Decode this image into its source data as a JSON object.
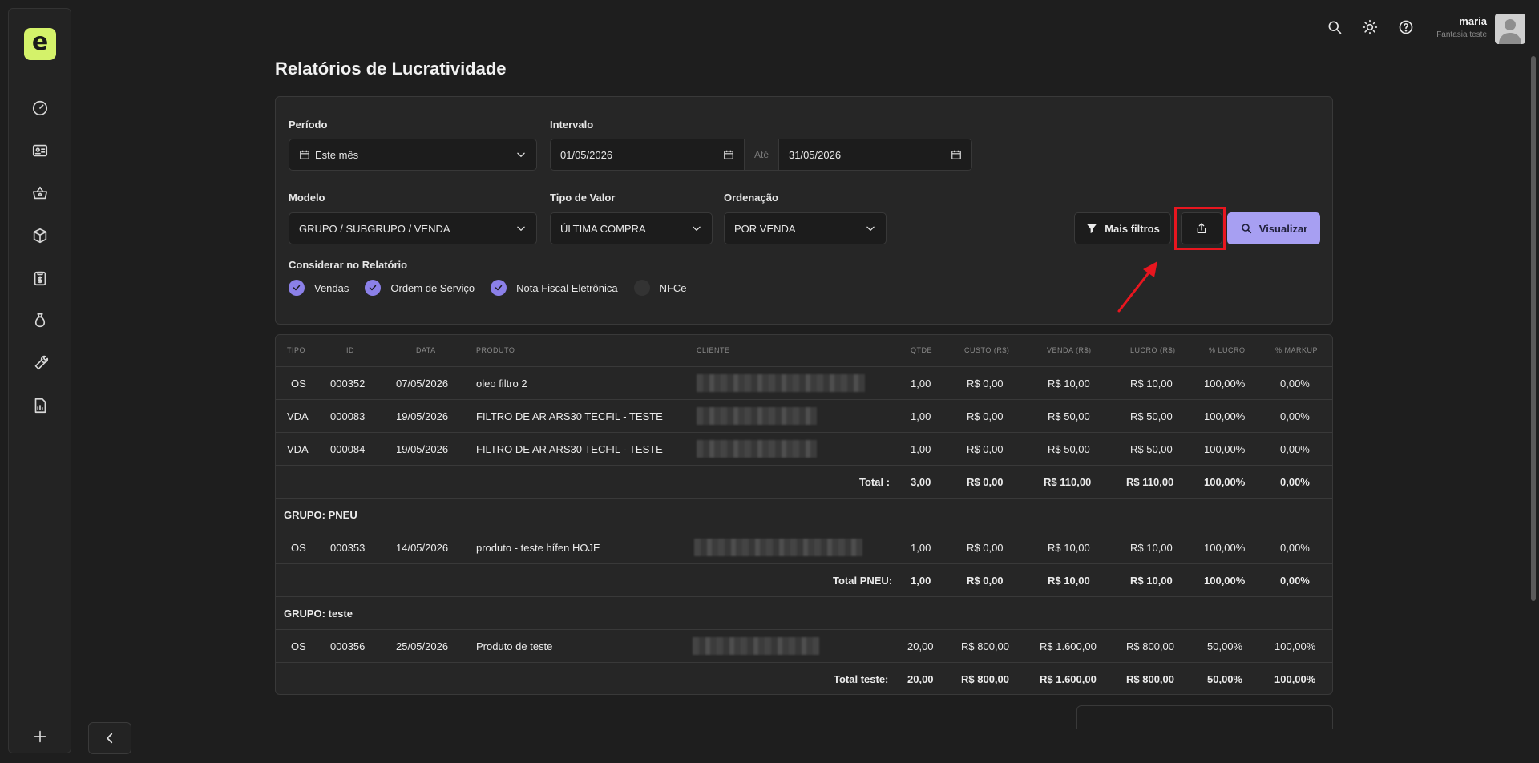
{
  "app": {
    "logo_letter": "e",
    "brand_color": "#d4f26a",
    "accent_color": "#a79ff2",
    "highlight_color": "#e8161f"
  },
  "sidebar": {
    "items": [
      {
        "icon": "dashboard-icon"
      },
      {
        "icon": "id-card-icon"
      },
      {
        "icon": "basket-icon"
      },
      {
        "icon": "box-icon"
      },
      {
        "icon": "clipboard-dollar-icon"
      },
      {
        "icon": "money-bag-icon"
      },
      {
        "icon": "wrench-icon"
      },
      {
        "icon": "report-icon"
      }
    ],
    "add_icon": "plus-icon",
    "collapse_icon": "chevron-left-icon"
  },
  "topbar": {
    "icons": [
      "search-icon",
      "sun-icon",
      "help-icon"
    ],
    "user_name": "maria",
    "user_subtitle": "Fantasia teste"
  },
  "page": {
    "title": "Relatórios de Lucratividade"
  },
  "filters": {
    "periodo_label": "Período",
    "periodo_value": "Este mês",
    "intervalo_label": "Intervalo",
    "date_from": "01/05/2026",
    "ate_label": "Até",
    "date_to": "31/05/2026",
    "modelo_label": "Modelo",
    "modelo_value": "GRUPO / SUBGRUPO / VENDA",
    "tipo_valor_label": "Tipo de Valor",
    "tipo_valor_value": "ÚLTIMA COMPRA",
    "ordenacao_label": "Ordenação",
    "ordenacao_value": "POR VENDA",
    "considerar_label": "Considerar no Relatório",
    "checks": [
      {
        "label": "Vendas",
        "checked": true
      },
      {
        "label": "Ordem de Serviço",
        "checked": true
      },
      {
        "label": "Nota Fiscal Eletrônica",
        "checked": true
      },
      {
        "label": "NFCe",
        "checked": false
      }
    ],
    "mais_filtros_label": "Mais filtros",
    "export_icon": "share-export-icon",
    "visualizar_label": "Visualizar"
  },
  "table": {
    "headers": [
      "TIPO",
      "ID",
      "DATA",
      "PRODUTO",
      "CLIENTE",
      "QTDE",
      "CUSTO (R$)",
      "VENDA (R$)",
      "LUCRO (R$)",
      "% LUCRO",
      "% MARKUP"
    ],
    "rows": [
      {
        "tipo": "OS",
        "id": "000352",
        "data": "07/05/2026",
        "produto": "oleo filtro 2",
        "qtde": "1,00",
        "custo": "R$ 0,00",
        "venda": "R$ 10,00",
        "lucro": "R$ 10,00",
        "pl": "100,00%",
        "pm": "0,00%"
      },
      {
        "tipo": "VDA",
        "id": "000083",
        "data": "19/05/2026",
        "produto": "FILTRO DE AR ARS30 TECFIL - TESTE",
        "qtde": "1,00",
        "custo": "R$ 0,00",
        "venda": "R$ 50,00",
        "lucro": "R$ 50,00",
        "pl": "100,00%",
        "pm": "0,00%"
      },
      {
        "tipo": "VDA",
        "id": "000084",
        "data": "19/05/2026",
        "produto": "FILTRO DE AR ARS30 TECFIL - TESTE",
        "qtde": "1,00",
        "custo": "R$ 0,00",
        "venda": "R$ 50,00",
        "lucro": "R$ 50,00",
        "pl": "100,00%",
        "pm": "0,00%"
      }
    ],
    "total1": {
      "label": "Total :",
      "qtde": "3,00",
      "custo": "R$ 0,00",
      "venda": "R$ 110,00",
      "lucro": "R$ 110,00",
      "pl": "100,00%",
      "pm": "0,00%"
    },
    "group_pneu": "GRUPO: PNEU",
    "pneu_row": {
      "tipo": "OS",
      "id": "000353",
      "data": "14/05/2026",
      "produto": "produto - teste hífen HOJE",
      "qtde": "1,00",
      "custo": "R$ 0,00",
      "venda": "R$ 10,00",
      "lucro": "R$ 10,00",
      "pl": "100,00%",
      "pm": "0,00%"
    },
    "total_pneu": {
      "label": "Total PNEU:",
      "qtde": "1,00",
      "custo": "R$ 0,00",
      "venda": "R$ 10,00",
      "lucro": "R$ 10,00",
      "pl": "100,00%",
      "pm": "0,00%"
    },
    "group_teste": "GRUPO: teste",
    "teste_row": {
      "tipo": "OS",
      "id": "000356",
      "data": "25/05/2026",
      "produto": "Produto de teste",
      "qtde": "20,00",
      "custo": "R$ 800,00",
      "venda": "R$ 1.600,00",
      "lucro": "R$ 800,00",
      "pl": "50,00%",
      "pm": "100,00%"
    },
    "total_teste": {
      "label": "Total teste:",
      "qtde": "20,00",
      "custo": "R$ 800,00",
      "venda": "R$ 1.600,00",
      "lucro": "R$ 800,00",
      "pl": "50,00%",
      "pm": "100,00%"
    }
  }
}
